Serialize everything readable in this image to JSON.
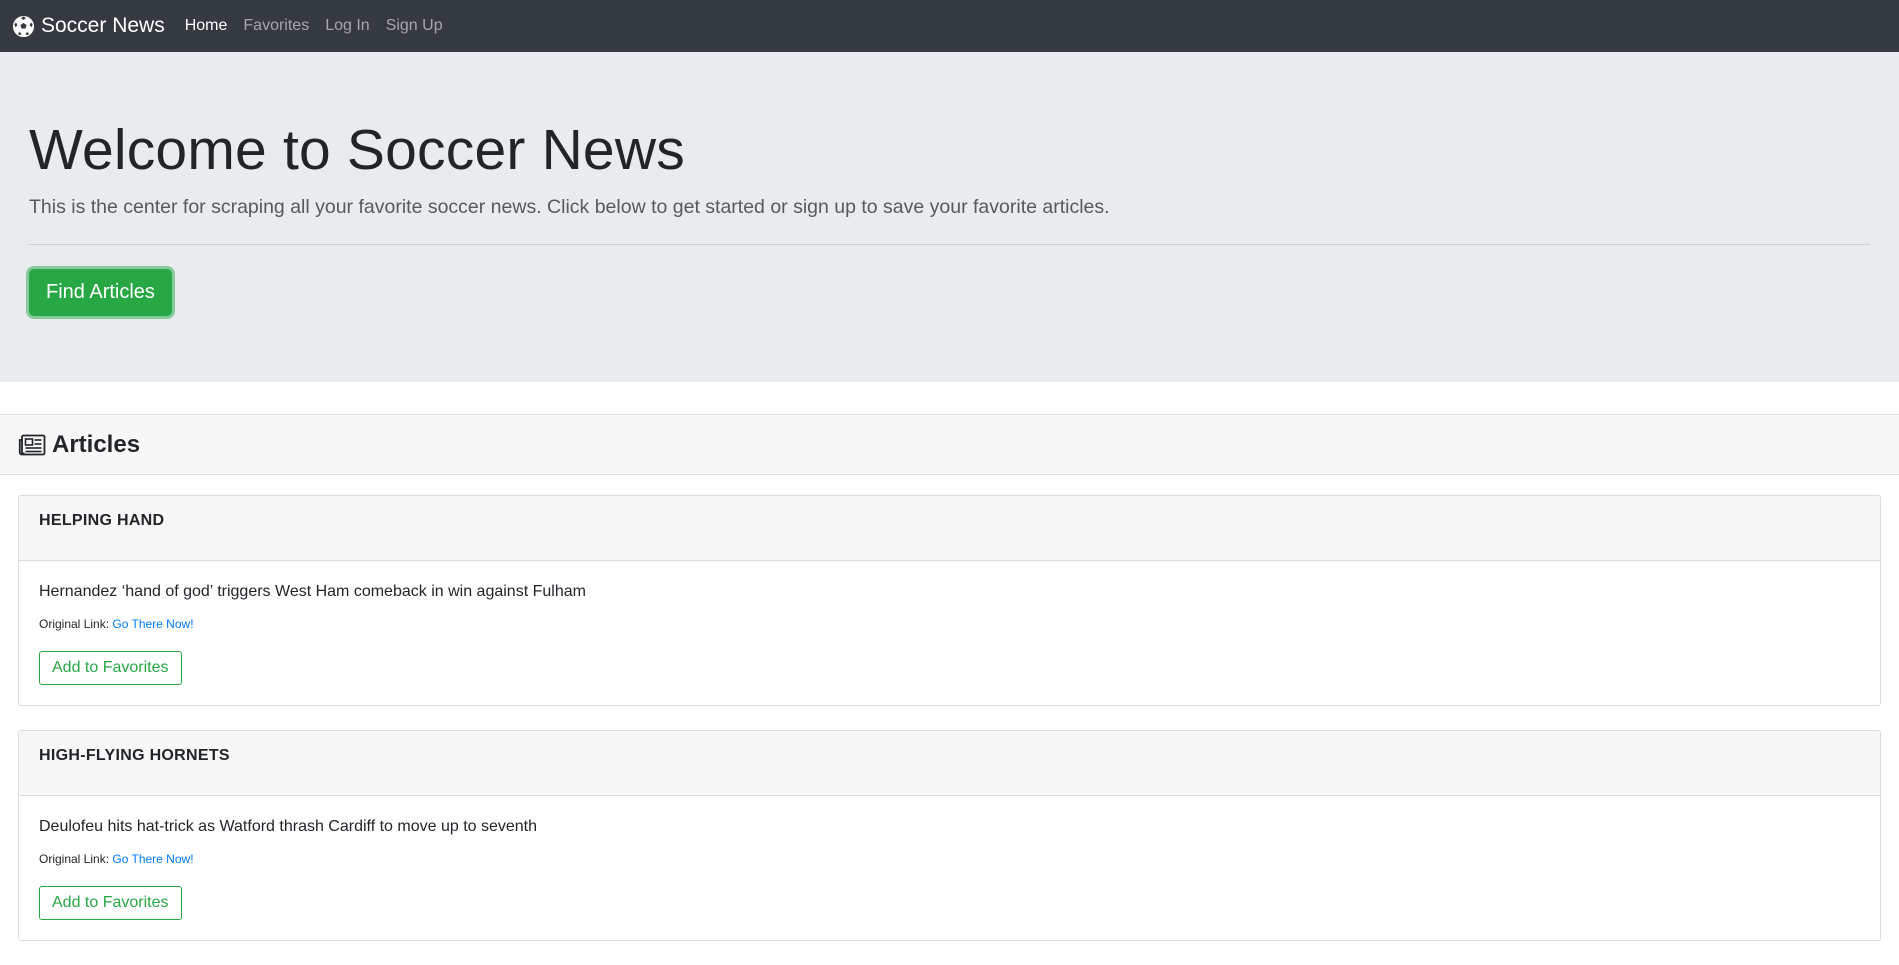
{
  "navbar": {
    "brand": "Soccer News",
    "brand_icon": "soccer-ball-icon",
    "links": [
      {
        "label": "Home",
        "active": true
      },
      {
        "label": "Favorites",
        "active": false
      },
      {
        "label": "Log In",
        "active": false
      },
      {
        "label": "Sign Up",
        "active": false
      }
    ]
  },
  "hero": {
    "title": "Welcome to Soccer News",
    "lead": "This is the center for scraping all your favorite soccer news. Click below to get started or sign up to save your favorite articles.",
    "button_label": "Find Articles"
  },
  "articles": {
    "heading": "Articles",
    "heading_icon": "newspaper-icon",
    "items": [
      {
        "headline": "HELPING HAND",
        "summary": "Hernandez ‘hand of god’ triggers West Ham comeback in win against Fulham",
        "link_prefix": "Original Link:",
        "link_text": "Go There Now!",
        "button_label": "Add to Favorites"
      },
      {
        "headline": "HIGH-FLYING HORNETS",
        "summary": "Deulofeu hits hat-trick as Watford thrash Cardiff to move up to seventh",
        "link_prefix": "Original Link:",
        "link_text": "Go There Now!",
        "button_label": "Add to Favorites"
      }
    ]
  },
  "colors": {
    "navbar_bg": "#343a40",
    "hero_bg": "#e9ecef",
    "success": "#28a745",
    "link": "#007bff"
  }
}
